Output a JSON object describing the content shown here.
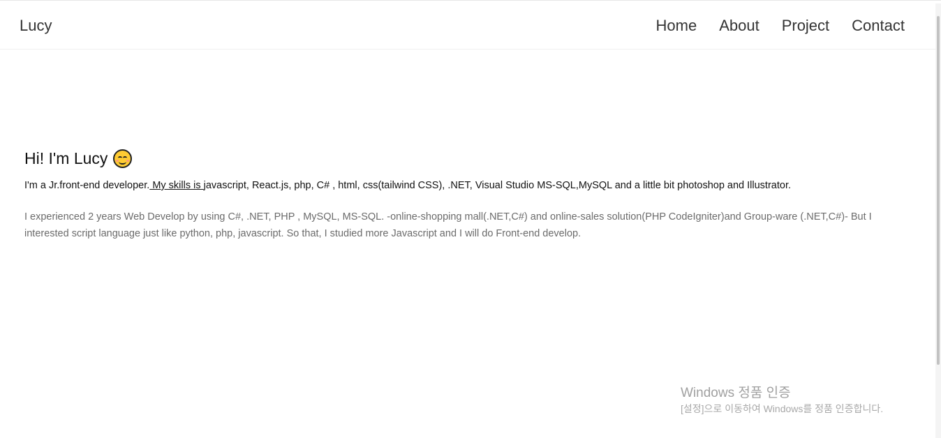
{
  "nav": {
    "brand": "Lucy",
    "links": [
      "Home",
      "About",
      "Project",
      "Contact"
    ]
  },
  "hero": {
    "title": "Hi! I'm Lucy",
    "emoji": "smiling-face-icon"
  },
  "skills": {
    "prefix": "I'm a Jr.front-end developer.",
    "underlined": " My skills is ",
    "list": " javascript, React.js, php, C# , html, css(tailwind CSS),  .NET, Visual Studio MS-SQL,MySQL and a little bit photoshop and Illustrator."
  },
  "experience": "I experienced 2 years Web Develop by using C#, .NET, PHP , MySQL, MS-SQL. -online-shopping mall(.NET,C#) and online-sales solution(PHP CodeIgniter)and Group-ware (.NET,C#)- But I interested script language just like python, php, javascript. So that, I studied more Javascript and I will do Front-end develop.",
  "watermark": {
    "title": "Windows 정품 인증",
    "subtitle": "[설정]으로 이동하여 Windows를 정품 인증합니다."
  }
}
